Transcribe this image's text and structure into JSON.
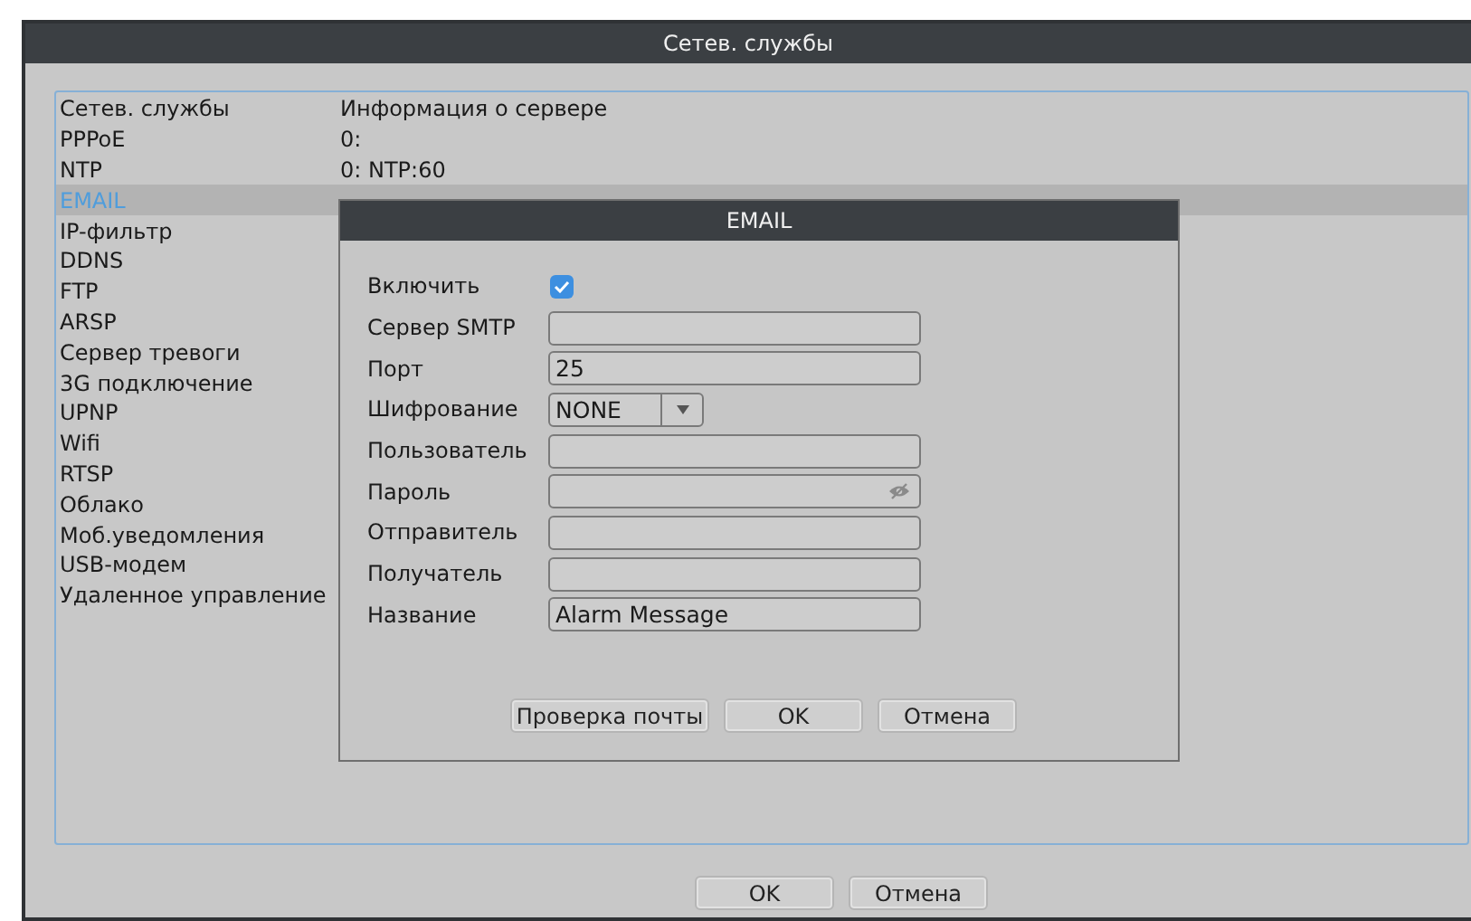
{
  "window": {
    "title": "Сетев. службы"
  },
  "table": {
    "columns": [
      "Сетев. службы",
      "Информация о сервере"
    ],
    "rows": [
      {
        "name": "PPPoE",
        "info": "0:",
        "selected": false
      },
      {
        "name": "NTP",
        "info": "0: NTP:60",
        "selected": false
      },
      {
        "name": "EMAIL",
        "selected": true
      },
      {
        "name": "IP-фильтр",
        "selected": false
      },
      {
        "name": "DDNS",
        "selected": false
      },
      {
        "name": "FTP",
        "selected": false
      },
      {
        "name": "ARSP",
        "selected": false
      },
      {
        "name": "Сервер тревоги",
        "selected": false
      },
      {
        "name": "3G подключение",
        "selected": false
      },
      {
        "name": "UPNP",
        "selected": false
      },
      {
        "name": "Wifi",
        "selected": false
      },
      {
        "name": "RTSP",
        "selected": false
      },
      {
        "name": "Облако",
        "selected": false
      },
      {
        "name": "Моб.уведомления",
        "selected": false
      },
      {
        "name": "USB-модем",
        "selected": false
      },
      {
        "name": "Удаленное управление",
        "selected": false
      }
    ]
  },
  "dialog": {
    "title": "EMAIL",
    "fields": [
      {
        "kind": "checkbox",
        "label": "Включить",
        "checked": true
      },
      {
        "kind": "text",
        "label": "Сервер SMTP"
      },
      {
        "kind": "text",
        "label": "Порт",
        "value": "25"
      },
      {
        "kind": "select",
        "label": "Шифрование",
        "value": "NONE"
      },
      {
        "kind": "text",
        "label": "Пользователь"
      },
      {
        "kind": "password",
        "label": "Пароль"
      },
      {
        "kind": "text",
        "label": "Отправитель"
      },
      {
        "kind": "text",
        "label": "Получатель"
      },
      {
        "kind": "text",
        "label": "Название",
        "value": "Alarm Message"
      }
    ],
    "buttons": [
      "Проверка почты",
      "OK",
      "Отмена"
    ]
  },
  "buttons": [
    "OK",
    "Отмена"
  ]
}
